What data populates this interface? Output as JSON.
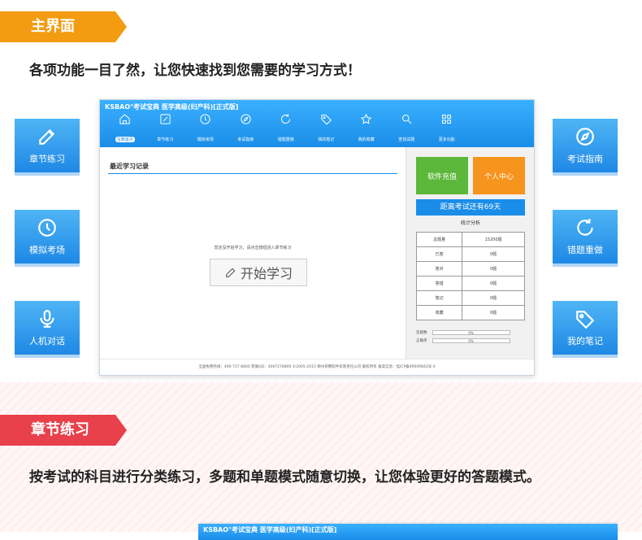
{
  "section1": {
    "tag": "主界面",
    "headline": "各项功能一目了然，让您快速找到您需要的学习方式！"
  },
  "side_cards": {
    "chapter": {
      "label": "章节练习",
      "icon": "edit-icon"
    },
    "mock": {
      "label": "模拟考场",
      "icon": "clock-icon"
    },
    "voice": {
      "label": "人机对话",
      "icon": "microphone-icon"
    },
    "guide": {
      "label": "考试指南",
      "icon": "compass-icon"
    },
    "redo": {
      "label": "错题重做",
      "icon": "refresh-icon"
    },
    "notes": {
      "label": "我的笔记",
      "icon": "tag-icon"
    }
  },
  "app": {
    "title": "KSBAO°考试宝典  医学高级(妇产科)[正式版]",
    "nav": [
      {
        "label": "宝典首页",
        "icon": "home-icon"
      },
      {
        "label": "章节练习",
        "icon": "edit-icon"
      },
      {
        "label": "模拟考场",
        "icon": "clock-icon"
      },
      {
        "label": "考试指南",
        "icon": "compass-icon"
      },
      {
        "label": "错题重做",
        "icon": "refresh-icon"
      },
      {
        "label": "我的笔记",
        "icon": "tag-icon"
      },
      {
        "label": "我的收藏",
        "icon": "star-icon"
      },
      {
        "label": "查找试题",
        "icon": "search-icon"
      },
      {
        "label": "更多功能",
        "icon": "grid-icon"
      }
    ],
    "recent_title": "最近学习记录",
    "empty_hint": "您还没开始学习，请点击按钮进入章节练习",
    "start_button": "开始学习",
    "recharge_button": "软件充值",
    "personal_button": "个人中心",
    "countdown": "距离考试还有69天",
    "stats_title": "统计分析",
    "stats": [
      {
        "label": "总题量",
        "value": "15200题"
      },
      {
        "label": "已答",
        "value": "0题"
      },
      {
        "label": "答对",
        "value": "0题"
      },
      {
        "label": "答错",
        "value": "0题"
      },
      {
        "label": "笔记",
        "value": "0题"
      },
      {
        "label": "收藏",
        "value": "0题"
      }
    ],
    "answered_rate_label": "答题数",
    "answered_rate": "0%",
    "correct_rate_label": "正确率",
    "correct_rate": "0%",
    "footer": "全国免费热线：400-727-8800  客服QQ：4007278800  ©2005-2015  柳州英腾软件有限责任公司 版权所有  备案信息：桂ICP备09009842号-4"
  },
  "section2": {
    "tag": "章节练习",
    "headline": "按考试的科目进行分类练习，多题和单题模式随意切换，让您体验更好的答题模式。",
    "app_title": "KSBAO°考试宝典  医学高级(妇产科)[正式版]"
  }
}
